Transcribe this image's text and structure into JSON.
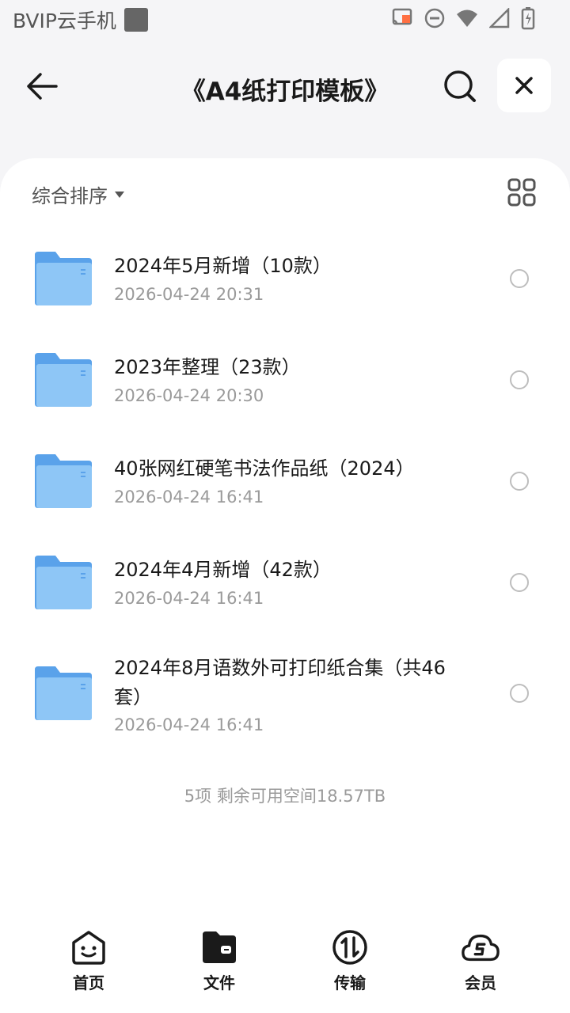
{
  "status_bar": {
    "carrier": "BVIP云手机"
  },
  "header": {
    "title": "《A4纸打印模板》"
  },
  "toolbar": {
    "sort_label": "综合排序"
  },
  "files": [
    {
      "name": "2024年5月新增（10款）",
      "date": "2026-04-24 20:31"
    },
    {
      "name": "2023年整理（23款）",
      "date": "2026-04-24 20:30"
    },
    {
      "name": "40张网红硬笔书法作品纸（2024）",
      "date": "2026-04-24 16:41"
    },
    {
      "name": "2024年4月新增（42款）",
      "date": "2026-04-24 16:41"
    },
    {
      "name": "2024年8月语数外可打印纸合集（共46套）",
      "date": "2026-04-24 16:41"
    }
  ],
  "footer": {
    "summary": "5项 剩余可用空间18.57TB"
  },
  "nav": {
    "home": "首页",
    "files": "文件",
    "transfer": "传输",
    "vip": "会员"
  },
  "colors": {
    "folder": "#7cb9f2",
    "folder_dark": "#5aa2ea",
    "accent_cast": "#ff7043"
  }
}
